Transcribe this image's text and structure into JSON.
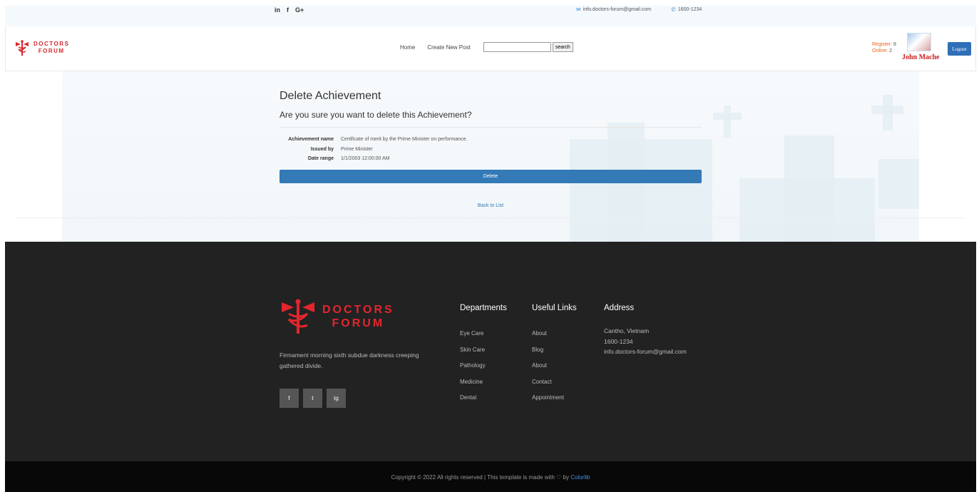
{
  "topbar": {
    "social": [
      "in",
      "f",
      "G+"
    ],
    "email": "info.doctors-forum@gmail.com",
    "phone": "1600-1234"
  },
  "header": {
    "logo_line1": "DOCTORS",
    "logo_line2": "FORUM",
    "nav": [
      "Home",
      "Create New Post"
    ],
    "search_placeholder": "",
    "search_button": "search",
    "register_label": "Register:",
    "register_count": "8",
    "online_label": "Online:",
    "online_count": "2",
    "user_name": "John Mache",
    "logout": "Logout"
  },
  "main": {
    "title": "Delete Achievement",
    "question": "Are you sure you want to delete this Achievement?",
    "details": [
      {
        "label": "Achievement name",
        "value": "Certificate of merit by the Prime Minister on performance."
      },
      {
        "label": "Issued by",
        "value": "Prime Minister"
      },
      {
        "label": "Date range",
        "value": "1/1/2003 12:00:00 AM"
      }
    ],
    "delete_button": "Delete",
    "back_link": "Back to List"
  },
  "footer": {
    "logo_line1": "DOCTORS",
    "logo_line2": "FORUM",
    "description": "Firmament morning sixth subdue darkness creeping gathered divide.",
    "social": [
      "f",
      "t",
      "ig"
    ],
    "departments": {
      "title": "Departments",
      "items": [
        "Eye Care",
        "Skin Care",
        "Pathology",
        "Medicine",
        "Dental"
      ]
    },
    "useful_links": {
      "title": "Useful Links",
      "items": [
        "About",
        "Blog",
        "About",
        "Contact",
        "Appointment"
      ]
    },
    "address": {
      "title": "Address",
      "lines": [
        "Cantho, Vietnam",
        "1600-1234",
        "info.doctors-forum@gmail.com"
      ]
    },
    "copyright": "Copyright © 2022 All rights reserved | This template is made with ♡ by",
    "copyright_link": "Colorlib"
  },
  "colors": {
    "brand_red": "#d9272d",
    "primary_blue": "#337ab7",
    "footer_bg": "#222222",
    "copybar_bg": "#080808"
  }
}
